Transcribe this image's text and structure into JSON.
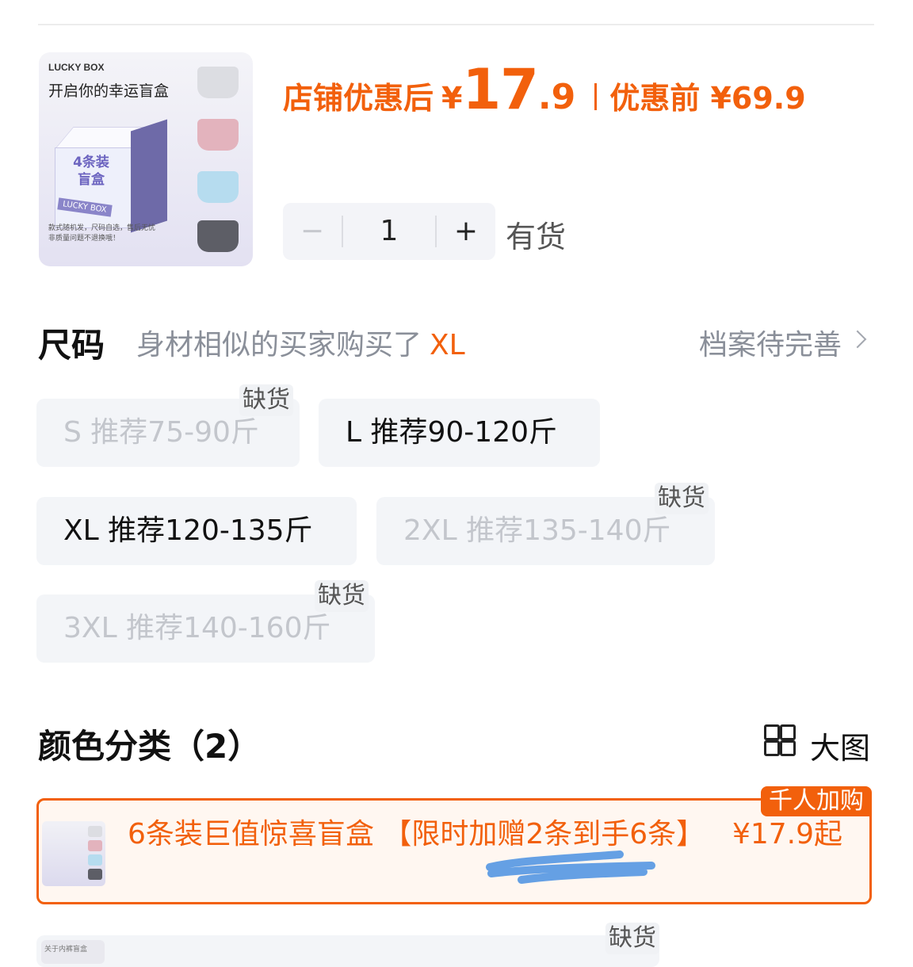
{
  "product_image": {
    "brand": "LUCKY BOX",
    "tagline": "开启你的幸运盲盒",
    "box_label": "4条装\n盲盒",
    "box_tag": "LUCKY BOX",
    "fine_print": "款式随机发，尺码自选，售后无忧\n非质量问题不退换哦！"
  },
  "price": {
    "after_label": "店铺优惠后",
    "currency": "¥",
    "after_int": "17",
    "after_dec": ".9",
    "before_label": "优惠前 ¥69.9"
  },
  "quantity": {
    "minus": "−",
    "value": "1",
    "plus": "+"
  },
  "stock_status": "有货",
  "size_section": {
    "title": "尺码",
    "hint_prefix": "身材相似的买家购买了",
    "hint_value": "XL",
    "profile_link": "档案待完善",
    "options": [
      {
        "label": "S 推荐75-90斤",
        "badge": "缺货"
      },
      {
        "label": "L 推荐90-120斤",
        "badge": ""
      },
      {
        "label": "XL 推荐120-135斤",
        "badge": ""
      },
      {
        "label": "2XL 推荐135-140斤",
        "badge": "缺货"
      },
      {
        "label": "3XL 推荐140-160斤",
        "badge": "缺货"
      }
    ]
  },
  "color_section": {
    "title": "颜色分类（2）",
    "view_toggle": "大图",
    "variants": [
      {
        "name": "6条装巨值惊喜盲盒 【限时加赠2条到手6条】",
        "price": "¥17.9起",
        "tag": "千人加购"
      },
      {
        "name": "",
        "price": "",
        "badge": "缺货",
        "thumb_text": "关于内裤盲盒"
      }
    ]
  },
  "colors": {
    "accent": "#f2600c",
    "chip_bg": "#f3f5f8",
    "muted": "#8a8f99"
  }
}
